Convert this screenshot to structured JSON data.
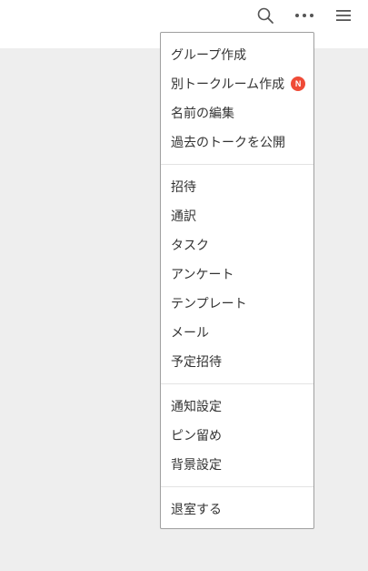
{
  "header": {
    "icons": [
      "search-icon",
      "more-horizontal-icon",
      "hamburger-menu-icon"
    ]
  },
  "colors": {
    "badge": "#ef4b37",
    "backdrop": "#eeeeee",
    "text": "#333333"
  },
  "menu": {
    "groups": [
      {
        "items": [
          {
            "label": "グループ作成"
          },
          {
            "label": "別トークルーム作成",
            "badge": "N"
          },
          {
            "label": "名前の編集"
          },
          {
            "label": "過去のトークを公開"
          }
        ]
      },
      {
        "items": [
          {
            "label": "招待"
          },
          {
            "label": "通訳"
          },
          {
            "label": "タスク"
          },
          {
            "label": "アンケート"
          },
          {
            "label": "テンプレート"
          },
          {
            "label": "メール"
          },
          {
            "label": "予定招待"
          }
        ]
      },
      {
        "items": [
          {
            "label": "通知設定"
          },
          {
            "label": "ピン留め"
          },
          {
            "label": "背景設定"
          }
        ]
      },
      {
        "items": [
          {
            "label": "退室する"
          }
        ]
      }
    ]
  }
}
